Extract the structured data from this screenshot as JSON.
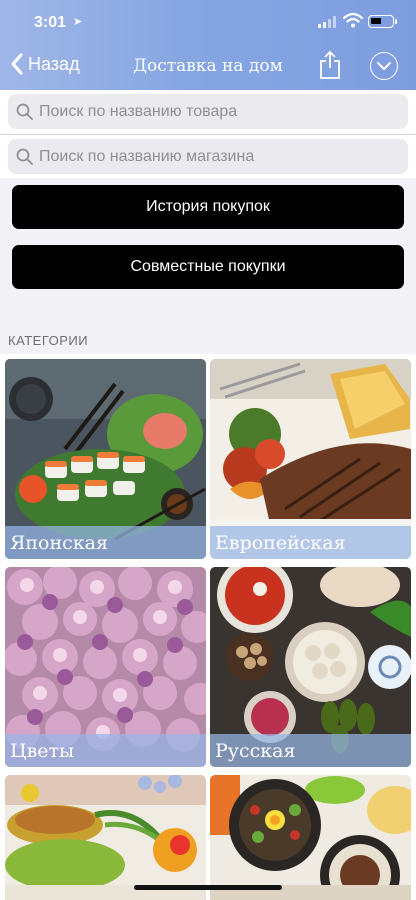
{
  "status_bar": {
    "time": "3:01"
  },
  "nav": {
    "back_label": "Назад",
    "title": "Доставка на дом"
  },
  "search": {
    "product_placeholder": "Поиск по названию товара",
    "product_value": "",
    "shop_placeholder": "Поиск по названию магазина",
    "shop_value": ""
  },
  "buttons": {
    "history": "История покупок",
    "joint": "Совместные покупки"
  },
  "categories": {
    "header": "КАТЕГОРИИ",
    "items": [
      {
        "label": "Японская"
      },
      {
        "label": "Европейская"
      },
      {
        "label": "Цветы"
      },
      {
        "label": "Русская"
      },
      {
        "label": ""
      },
      {
        "label": ""
      }
    ]
  },
  "colors": {
    "header_gradient_start": "#9fb6e8",
    "header_gradient_end": "#7d9ddf",
    "tile_label_overlay": "#97b5e6",
    "button_bg": "#000000"
  }
}
